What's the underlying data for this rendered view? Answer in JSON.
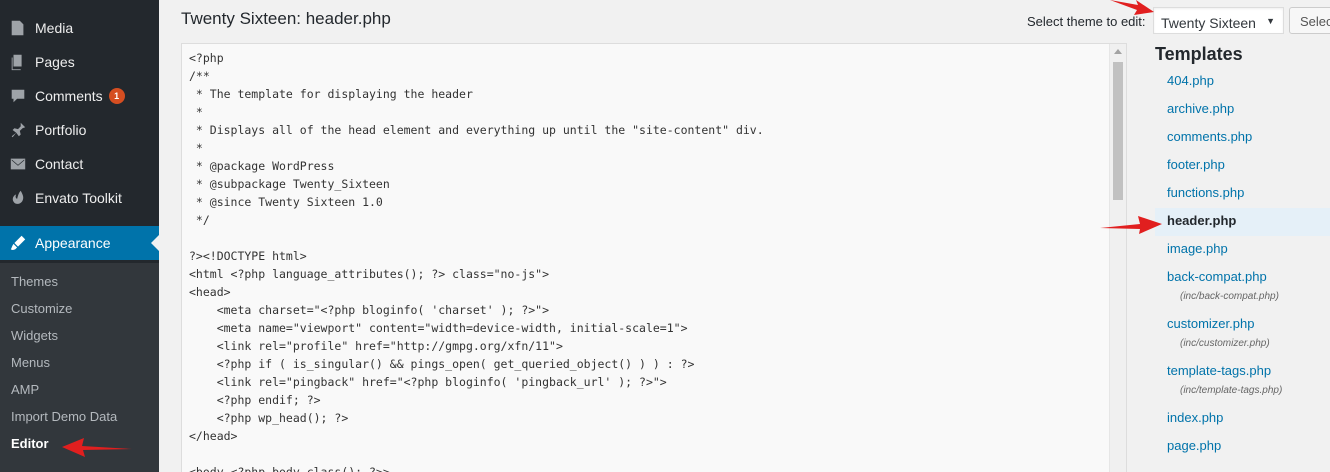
{
  "sidebar": {
    "items": [
      {
        "label": "Media",
        "icon": "media-icon"
      },
      {
        "label": "Pages",
        "icon": "pages-icon"
      },
      {
        "label": "Comments",
        "icon": "comments-icon",
        "badge": "1"
      },
      {
        "label": "Portfolio",
        "icon": "portfolio-icon"
      },
      {
        "label": "Contact",
        "icon": "contact-icon"
      },
      {
        "label": "Envato Toolkit",
        "icon": "envato-icon"
      },
      {
        "label": "Appearance",
        "icon": "appearance-icon"
      }
    ],
    "submenu": [
      "Themes",
      "Customize",
      "Widgets",
      "Menus",
      "AMP",
      "Import Demo Data",
      "Editor"
    ]
  },
  "header": {
    "title": "Twenty Sixteen: header.php",
    "select_label": "Select theme to edit:",
    "selected_theme": "Twenty Sixteen",
    "select_button": "Selec"
  },
  "editor": {
    "code": "<?php\n/**\n * The template for displaying the header\n *\n * Displays all of the head element and everything up until the \"site-content\" div.\n *\n * @package WordPress\n * @subpackage Twenty_Sixteen\n * @since Twenty Sixteen 1.0\n */\n\n?><!DOCTYPE html>\n<html <?php language_attributes(); ?> class=\"no-js\">\n<head>\n    <meta charset=\"<?php bloginfo( 'charset' ); ?>\">\n    <meta name=\"viewport\" content=\"width=device-width, initial-scale=1\">\n    <link rel=\"profile\" href=\"http://gmpg.org/xfn/11\">\n    <?php if ( is_singular() && pings_open( get_queried_object() ) ) : ?>\n    <link rel=\"pingback\" href=\"<?php bloginfo( 'pingback_url' ); ?>\">\n    <?php endif; ?>\n    <?php wp_head(); ?>\n</head>\n\n<body <?php body_class(); ?>>"
  },
  "templates": {
    "title": "Templates",
    "files": [
      {
        "name": "404.php"
      },
      {
        "name": "archive.php"
      },
      {
        "name": "comments.php"
      },
      {
        "name": "footer.php"
      },
      {
        "name": "functions.php"
      },
      {
        "name": "header.php"
      },
      {
        "name": "image.php"
      },
      {
        "name": "back-compat.php",
        "path": "(inc/back-compat.php)"
      },
      {
        "name": "customizer.php",
        "path": "(inc/customizer.php)"
      },
      {
        "name": "template-tags.php",
        "path": "(inc/template-tags.php)"
      },
      {
        "name": "index.php"
      },
      {
        "name": "page.php"
      }
    ]
  },
  "colors": {
    "sidebar_bg": "#23282d",
    "active_blue": "#0073aa",
    "arrow_red": "#e11f1f"
  }
}
